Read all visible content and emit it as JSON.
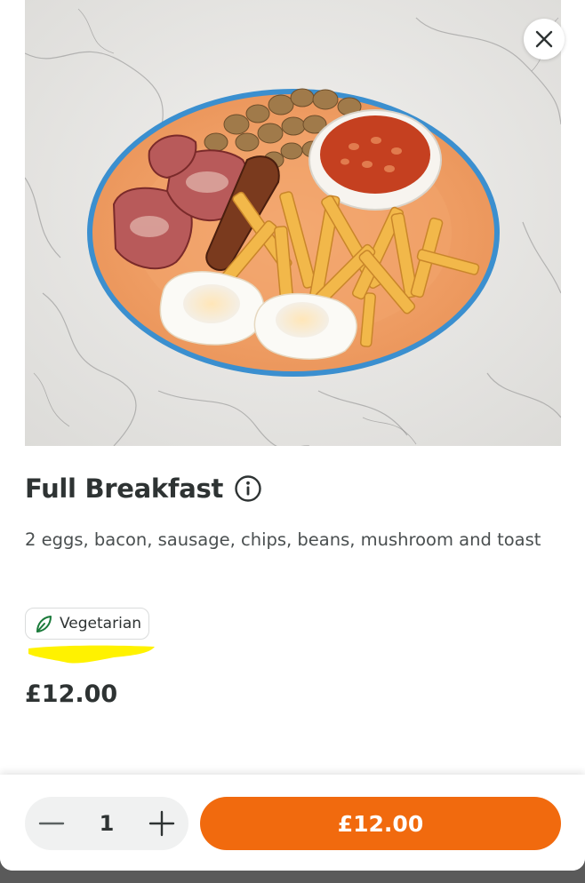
{
  "item": {
    "name": "Full Breakfast",
    "description": "2 eggs, bacon, sausage, chips, beans, mushroom and toast",
    "dietary_badge": {
      "label": "Vegetarian",
      "icon": "leaf-icon",
      "icon_color": "#1a7a3a"
    },
    "price": "£12.00",
    "image_alt": "Full breakfast plate with bacon, sausages, mushrooms, beans, chips and fried eggs"
  },
  "footer": {
    "quantity": "1",
    "add_button_label": "£12.00"
  },
  "colors": {
    "accent": "#f16a0e",
    "highlight_marker": "#fff200",
    "text_primary": "#2e3333"
  },
  "icons": {
    "close": "close-icon",
    "info": "info-icon",
    "minus": "minus-icon",
    "plus": "plus-icon"
  }
}
